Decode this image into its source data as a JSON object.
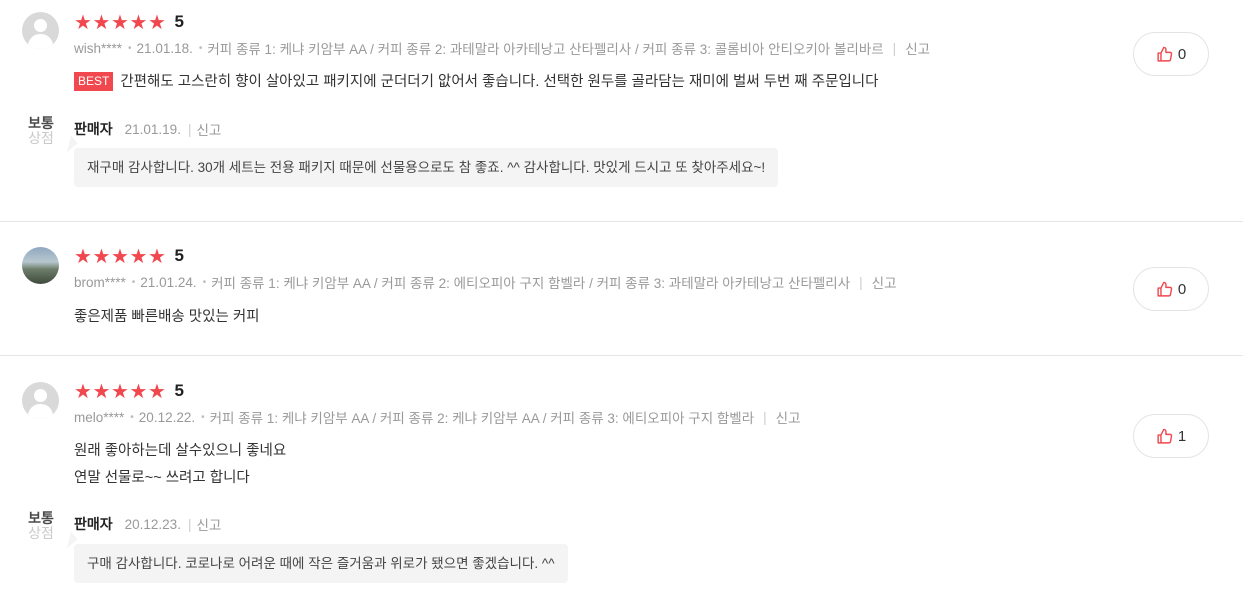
{
  "reviews": [
    {
      "avatar": "default-avatar-icon",
      "score": "5",
      "user": "wish****",
      "date": "21.01.18.",
      "options": "커피 종류 1: 케냐 키암부 AA / 커피 종류 2: 과테말라 아카테낭고 산타펠리사 / 커피 종류 3: 콜롬비아 안티오키아 볼리바르",
      "report": "신고",
      "badge": "BEST",
      "text": "간편해도 고스란히 향이 살아있고 패키지에 군더더기 앖어서 좋습니다. 선택한 원두를 골라담는 재미에 벌써 두번 째 주문입니다",
      "likes": "0",
      "seller": {
        "logo_top": "보통",
        "logo_bottom": "상점",
        "name": "판매자",
        "date": "21.01.19.",
        "report": "신고",
        "reply": "재구매 감사합니다. 30개 세트는 전용 패키지 때문에 선물용으로도 참 좋죠. ^^ 감사합니다. 맛있게 드시고 또 찾아주세요~!"
      }
    },
    {
      "avatar": "photo-avatar",
      "score": "5",
      "user": "brom****",
      "date": "21.01.24.",
      "options": "커피 종류 1: 케냐 키암부 AA / 커피 종류 2: 에티오피아 구지 함벨라 / 커피 종류 3: 과테말라 아카테낭고 산타펠리사",
      "report": "신고",
      "text": "좋은제품 빠른배송 맛있는 커피",
      "likes": "0"
    },
    {
      "avatar": "default-avatar-icon",
      "score": "5",
      "user": "melo****",
      "date": "20.12.22.",
      "options": "커피 종류 1: 케냐 키암부 AA / 커피 종류 2: 케냐 키암부 AA / 커피 종류 3: 에티오피아 구지 함벨라",
      "report": "신고",
      "text_line1": "원래 좋아하는데 살수있으니 좋네요",
      "text_line2": "연말 선물로~~ 쓰려고 합니다",
      "likes": "1",
      "seller": {
        "logo_top": "보통",
        "logo_bottom": "상점",
        "name": "판매자",
        "date": "20.12.23.",
        "report": "신고",
        "reply": "구매 감사합니다. 코로나로 어려운 때에 작은 즐거움과 위로가 됐으면 좋겠습니다. ^^"
      }
    }
  ],
  "rating_stars": 5,
  "colors": {
    "star": "#f0484e",
    "best_badge": "#f0484e",
    "like_icon": "#f0484e"
  },
  "icons": {
    "like": "thumbs-up-icon",
    "star": "star-icon"
  }
}
